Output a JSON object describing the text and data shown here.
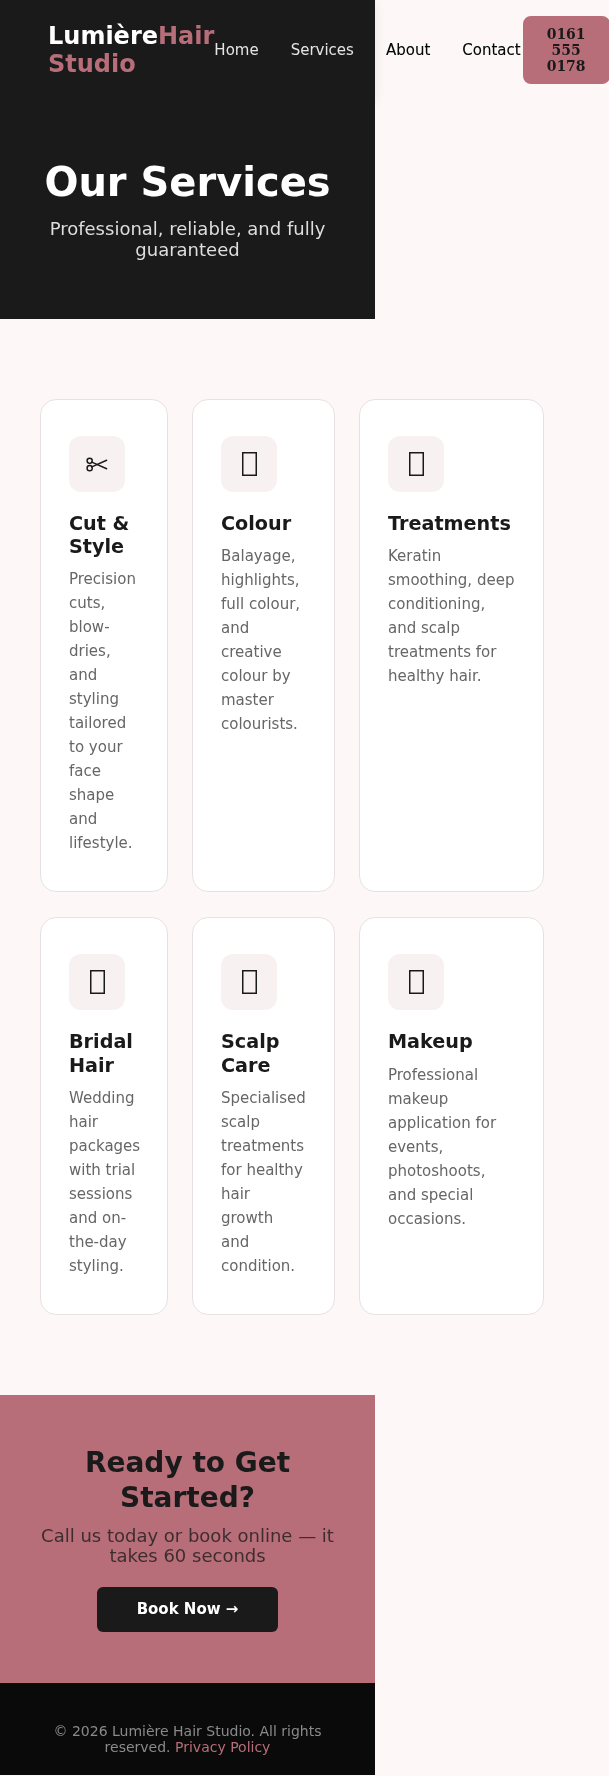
{
  "header": {
    "logo": {
      "name": "Lumière",
      "accent": "Hair Studio"
    },
    "nav": [
      "Home",
      "Services",
      "About",
      "Contact"
    ],
    "phone": "0161 555 0178"
  },
  "hero": {
    "title": "Our Services",
    "subtitle": "Professional, reliable, and fully guaranteed"
  },
  "services": [
    {
      "kind": "scissors",
      "title": "Cut & Style",
      "description": "Precision cuts, blow-dries, and styling tailored to your face shape and lifestyle."
    },
    {
      "kind": "tofu",
      "title": "Colour",
      "description": "Balayage, highlights, full colour, and creative colour by master colourists."
    },
    {
      "kind": "tofu",
      "title": "Treatments",
      "description": "Keratin smoothing, deep conditioning, and scalp treatments for healthy hair."
    },
    {
      "kind": "tofu",
      "title": "Bridal Hair",
      "description": "Wedding hair packages with trial sessions and on-the-day styling."
    },
    {
      "kind": "tofu",
      "title": "Scalp Care",
      "description": "Specialised scalp treatments for healthy hair growth and condition."
    },
    {
      "kind": "tofu",
      "title": "Makeup",
      "description": "Professional makeup application for events, photoshoots, and special occasions."
    }
  ],
  "cta": {
    "title": "Ready to Get Started?",
    "subtitle": "Call us today or book online — it takes 60 seconds",
    "button": "Book Now →"
  },
  "footer": {
    "copyright": "© 2026 Lumière Hair Studio. All rights reserved.",
    "link": "Privacy Policy"
  }
}
